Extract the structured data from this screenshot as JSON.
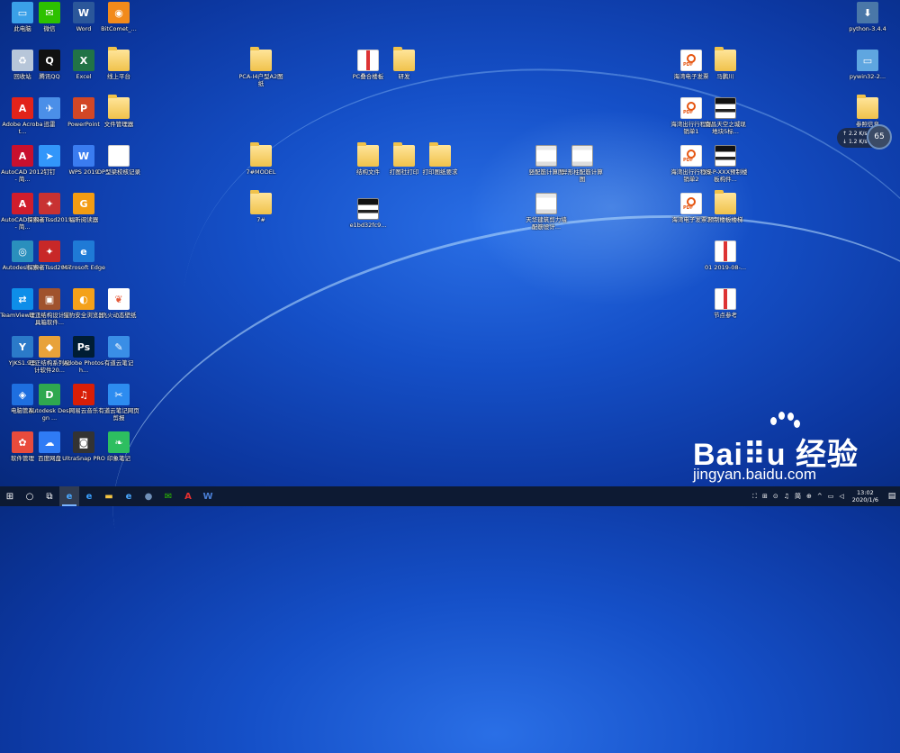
{
  "desktop_icons": [
    {
      "label": "此电脑",
      "type": "app",
      "color": "#3aa0e8",
      "glyph": "▭"
    },
    {
      "label": "微信",
      "type": "app",
      "color": "#2dc100",
      "glyph": "✉"
    },
    {
      "label": "Word",
      "type": "app",
      "color": "#2b579a",
      "glyph": "W"
    },
    {
      "label": "BitComet_...",
      "type": "app",
      "color": "#f28a1b",
      "glyph": "◉"
    },
    {
      "label": "回收站",
      "type": "app",
      "color": "#b7c6d9",
      "glyph": "♻"
    },
    {
      "label": "腾讯QQ",
      "type": "app",
      "color": "#111111",
      "glyph": "Q"
    },
    {
      "label": "Excel",
      "type": "app",
      "color": "#217346",
      "glyph": "X"
    },
    {
      "label": "线上平台",
      "type": "folder"
    },
    {
      "label": "Adobe Acrobat...",
      "type": "app",
      "color": "#e2231a",
      "glyph": "A"
    },
    {
      "label": "迅雷",
      "type": "app",
      "color": "#4b8fe8",
      "glyph": "✈"
    },
    {
      "label": "PowerPoint",
      "type": "app",
      "color": "#d24726",
      "glyph": "P"
    },
    {
      "label": "文件管理器",
      "type": "folder"
    },
    {
      "label": "AutoCAD 2012 - 简...",
      "type": "app",
      "color": "#c8102e",
      "glyph": "A"
    },
    {
      "label": "钉钉",
      "type": "app",
      "color": "#3296fa",
      "glyph": "➤"
    },
    {
      "label": "WPS 2019",
      "type": "app",
      "color": "#3a7cf0",
      "glyph": "W"
    },
    {
      "label": "DP型梁校核记录",
      "type": "doc"
    },
    {
      "label": "AutoCAD 2014 - 简...",
      "type": "app",
      "color": "#d01d2c",
      "glyph": "A"
    },
    {
      "label": "探索者Tssd2015",
      "type": "app",
      "color": "#c83232",
      "glyph": "✦"
    },
    {
      "label": "福昕阅读器",
      "type": "app",
      "color": "#f39c12",
      "glyph": "G"
    },
    {
      "label": "Autodesk 360",
      "type": "app",
      "color": "#2a8fbd",
      "glyph": "◎"
    },
    {
      "label": "探索者Tssd2017",
      "type": "app",
      "color": "#c82828",
      "glyph": "✦"
    },
    {
      "label": "Microsoft Edge",
      "type": "app",
      "color": "#1f7ad6",
      "glyph": "e"
    },
    {
      "label": "TeamViewer 14",
      "type": "app",
      "color": "#0e8ee9",
      "glyph": "⇄"
    },
    {
      "label": "理正结构设计工具箱软件...",
      "type": "app",
      "color": "#a0522d",
      "glyph": "▣"
    },
    {
      "label": "猎豹安全浏览器",
      "type": "app",
      "color": "#f4a11a",
      "glyph": "◐"
    },
    {
      "label": "飞火动态壁纸",
      "type": "app",
      "color": "#ffffff",
      "glyph": "❦"
    },
    {
      "label": "YJKS1.9.3",
      "type": "app",
      "color": "#2b7ac9",
      "glyph": "Y"
    },
    {
      "label": "理正结构系列设计软件20...",
      "type": "app",
      "color": "#e8a23a",
      "glyph": "◆"
    },
    {
      "label": "Adobe Photosh...",
      "type": "app",
      "color": "#001d34",
      "glyph": "Ps"
    },
    {
      "label": "有道云笔记",
      "type": "app",
      "color": "#3a8ee6",
      "glyph": "✎"
    },
    {
      "label": "电脑管家",
      "type": "app",
      "color": "#1e6fe0",
      "glyph": "◈"
    },
    {
      "label": "Autodesk Design ...",
      "type": "app",
      "color": "#2fa84f",
      "glyph": "D"
    },
    {
      "label": "网易云音乐",
      "type": "app",
      "color": "#d81e06",
      "glyph": "♫"
    },
    {
      "label": "有道云笔记网页剪报",
      "type": "app",
      "color": "#2d8cf0",
      "glyph": "✂"
    },
    {
      "label": "软件管理",
      "type": "app",
      "color": "#e94b3c",
      "glyph": "✿"
    },
    {
      "label": "百度网盘",
      "type": "app",
      "color": "#2f7bf5",
      "glyph": "☁"
    },
    {
      "label": "UltraSnap PRO",
      "type": "app",
      "color": "#333333",
      "glyph": "◙"
    },
    {
      "label": "印象笔记",
      "type": "app",
      "color": "#2dbe60",
      "glyph": "❧"
    },
    {
      "label": "PCA-I4户型A2图纸",
      "type": "folder"
    },
    {
      "label": "7#MODEL",
      "type": "folder"
    },
    {
      "label": "7#",
      "type": "folder"
    },
    {
      "label": "PC叠合楼板",
      "type": "imgthumb2"
    },
    {
      "label": "研发",
      "type": "folder"
    },
    {
      "label": "结构文件",
      "type": "folder"
    },
    {
      "label": "打图社打印",
      "type": "folder"
    },
    {
      "label": "打印图纸要求",
      "type": "folder"
    },
    {
      "label": "e1bd32fc9...",
      "type": "imgthumb"
    },
    {
      "label": "竖配筋计算图",
      "type": "shot"
    },
    {
      "label": "异形柱配筋计算图",
      "type": "shot"
    },
    {
      "label": "天华建筑剪力墙配筋设计...",
      "type": "shot"
    },
    {
      "label": "海湾电子发票",
      "type": "pdf"
    },
    {
      "label": "马鹏川",
      "type": "folder"
    },
    {
      "label": "海湾出行行程报销单1",
      "type": "pdf"
    },
    {
      "label": "南昌天空之城现地块5标...",
      "type": "imgthumb"
    },
    {
      "label": "海湾出行行程报销单2",
      "type": "pdf"
    },
    {
      "label": "YS-P-XXX预制楼板构件...",
      "type": "imgthumb"
    },
    {
      "label": "海湾电子发票2",
      "type": "pdf"
    },
    {
      "label": "预制楼板楼梯",
      "type": "folder"
    },
    {
      "label": "01 2019-08-...",
      "type": "imgthumb2"
    },
    {
      "label": "节点参考",
      "type": "imgthumb2"
    },
    {
      "label": "python-3.4.4",
      "type": "app",
      "color": "#4a77a8",
      "glyph": "⬇"
    },
    {
      "label": "pywin32-2...",
      "type": "app",
      "color": "#5fa6e0",
      "glyph": "▭"
    },
    {
      "label": "参照信息",
      "type": "folder"
    }
  ],
  "net_widget": {
    "up": "2.2",
    "up_unit": "K/s",
    "down": "1.2",
    "down_unit": "K/s",
    "percent": "65"
  },
  "watermark": {
    "brand": "Bai⠿u 经验",
    "url": "jingyan.baidu.com"
  },
  "taskbar": {
    "tray": [
      "⛶",
      "⊞",
      "⊙",
      "♫",
      "简",
      "⊕"
    ],
    "time": "13:02",
    "date": "2020/1/6"
  }
}
